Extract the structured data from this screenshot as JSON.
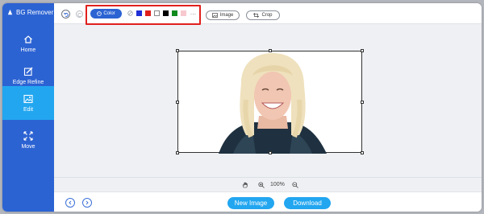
{
  "app": {
    "title": "BG Remover"
  },
  "sidebar": {
    "items": [
      {
        "label": "Home",
        "icon": "home-icon"
      },
      {
        "label": "Edge Refine",
        "icon": "edge-refine-icon"
      },
      {
        "label": "Edit",
        "icon": "image-edit-icon",
        "active": true
      },
      {
        "label": "Move",
        "icon": "move-arrows-icon"
      }
    ]
  },
  "toolbar": {
    "color_label": "Color",
    "swatches": [
      "#1f2fd6",
      "#e0201c",
      "#ffffff",
      "#000000",
      "#108a1e",
      "#f7c9cf"
    ],
    "more_label": "...",
    "image_label": "Image",
    "crop_label": "Crop"
  },
  "zoom": {
    "value": "100%"
  },
  "footer": {
    "new_image_label": "New Image",
    "download_label": "Download"
  },
  "colors": {
    "sidebar": "#2c63d3",
    "active": "#22a6f0",
    "highlight": "#e0201c",
    "primary_button": "#22a6f0"
  }
}
